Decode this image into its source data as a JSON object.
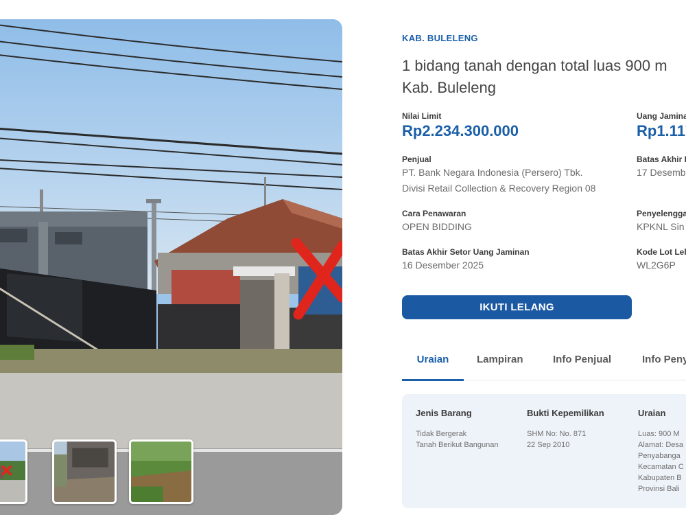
{
  "listing": {
    "region": "KAB. BULELENG",
    "title_line1": "1 bidang tanah dengan total luas 900 m",
    "title_line2": "Kab. Buleleng"
  },
  "fields": {
    "nilai_limit_label": "Nilai Limit",
    "nilai_limit_value": "Rp2.234.300.000",
    "uang_jaminan_label": "Uang Jamina",
    "uang_jaminan_value": "Rp1.117",
    "penjual_label": "Penjual",
    "penjual_line1": "PT. Bank Negara Indonesia (Persero) Tbk.",
    "penjual_line2": "Divisi Retail Collection & Recovery Region 08",
    "batas_akhir_label": "Batas Akhir I",
    "batas_akhir_value": "17 Desemb",
    "cara_penawaran_label": "Cara Penawaran",
    "cara_penawaran_value": "OPEN BIDDING",
    "penyelenggara_label": "Penyelengga",
    "penyelenggara_value": "KPKNL Sin",
    "batas_setor_label": "Batas Akhir Setor Uang Jaminan",
    "batas_setor_value": "16 Desember 2025",
    "kode_lot_label": "Kode Lot Lela",
    "kode_lot_value": "WL2G6P"
  },
  "actions": {
    "follow_label": "IKUTI LELANG"
  },
  "tabs": [
    {
      "label": "Uraian",
      "active": true
    },
    {
      "label": "Lampiran",
      "active": false
    },
    {
      "label": "Info Penjual",
      "active": false
    },
    {
      "label": "Info Peny",
      "active": false
    }
  ],
  "info_card": {
    "jenis_barang": {
      "heading": "Jenis Barang",
      "lines": [
        "Tidak Bergerak",
        "Tanah Berikut Bangunan"
      ]
    },
    "bukti_kepemilikan": {
      "heading": "Bukti Kepemilikan",
      "lines": [
        "SHM No: No. 871",
        "22 Sep 2010"
      ]
    },
    "uraian": {
      "heading": "Uraian",
      "lines": [
        "Luas: 900 M",
        "Alamat: Desa",
        "Penyabanga",
        "Kecamatan C",
        "Kabupaten B",
        "Provinsi Bali"
      ]
    }
  },
  "gallery": {
    "main_photo_icon": "property-photo",
    "thumbnail_count": 3
  },
  "colors": {
    "accent": "#1a5fa8",
    "button": "#1b5aa2",
    "card_bg": "#eef3f9",
    "mark_x": "#e0261c"
  }
}
